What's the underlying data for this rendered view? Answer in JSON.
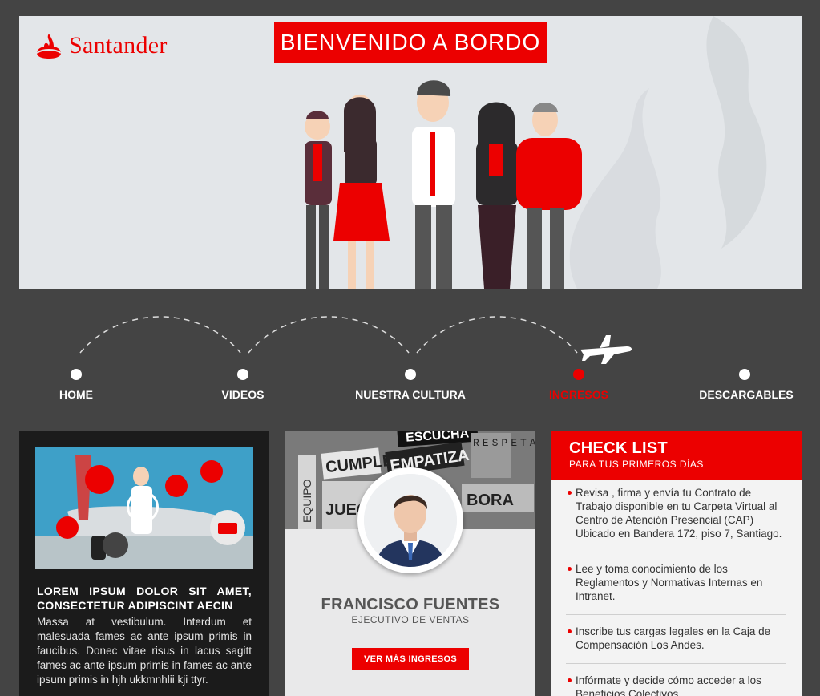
{
  "hero": {
    "brand": "Santander",
    "welcome": "BIENVENIDO A BORDO"
  },
  "nav": [
    {
      "label": "HOME",
      "active": false
    },
    {
      "label": "VIDEOS",
      "active": false
    },
    {
      "label": "NUESTRA CULTURA",
      "active": false
    },
    {
      "label": "INGRESOS",
      "active": true
    },
    {
      "label": "DESCARGABLES",
      "active": false
    }
  ],
  "video_card": {
    "title": "LOREM IPSUM DOLOR SIT AMET, CONSECTETUR ADIPISCINT AECIN",
    "body": "Massa at vestibulum. Interdum et malesuada fames ac ante ipsum primis in faucibus. Donec vitae risus in lacus sagitt fames ac ante ipsum primis in  fames ac ante ipsum primis in hjh ukkmnhlii kji ttyr."
  },
  "profile_card": {
    "name": "FRANCISCO FUENTES",
    "role": "EJECUTIVO DE VENTAS",
    "button": "VER MÁS INGRESOS",
    "wall_words": [
      "CUMPLE",
      "EMPATIZA",
      "ESCUCHA",
      "EQUIPO",
      "JUEG",
      "BORA",
      "RESPETA"
    ]
  },
  "checklist": {
    "title": "CHECK LIST",
    "subtitle": "PARA TUS  PRIMEROS  DÍAS",
    "items": [
      "Revisa , firma y envía tu Contrato de Trabajo disponible en tu Carpeta Virtual al Centro de Atención Presencial  (CAP) Ubicado en Bandera 172, piso 7, Santiago.",
      "Lee y toma conocimiento de los Reglamentos y Normativas Internas en Intranet.",
      "Inscribe tus cargas legales en la Caja de Compensación Los Andes.",
      "Infórmate  y  decide cómo acceder a los Beneficios Colectivos."
    ]
  },
  "colors": {
    "brand_red": "#ec0000",
    "page_bg": "#444444"
  }
}
